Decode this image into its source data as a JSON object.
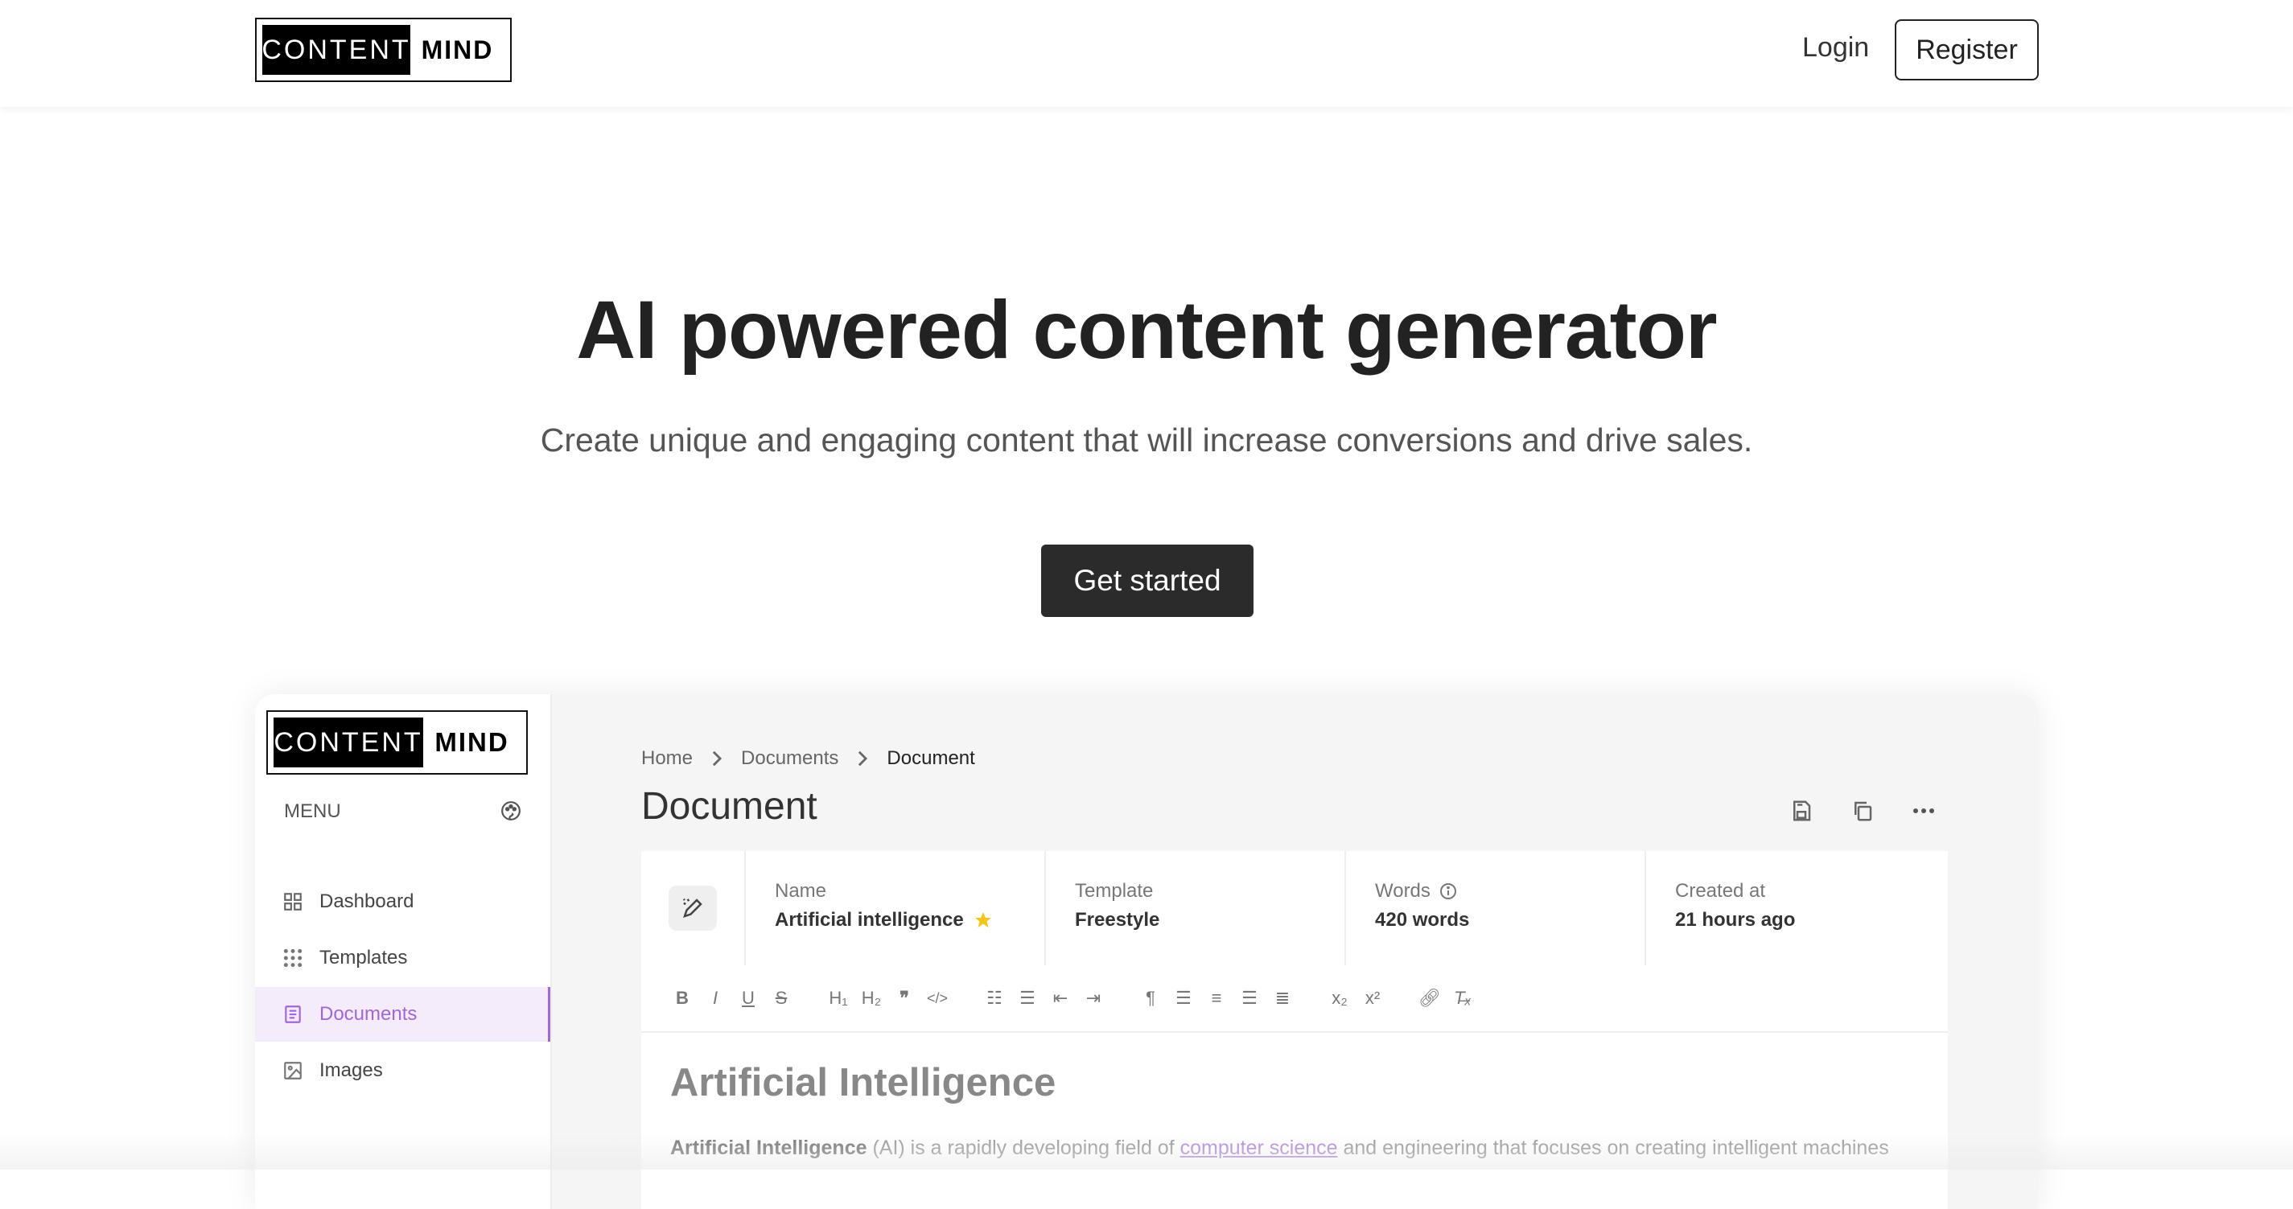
{
  "brand": {
    "part1": "CONTENT",
    "part2": "MIND"
  },
  "nav": {
    "login": "Login",
    "register": "Register"
  },
  "hero": {
    "title": "AI powered content generator",
    "subtitle": "Create unique and engaging content that will increase conversions and drive sales.",
    "cta": "Get started"
  },
  "app": {
    "sidebar": {
      "menu_label": "MENU",
      "items": [
        {
          "label": "Dashboard",
          "icon": "grid-icon",
          "active": false
        },
        {
          "label": "Templates",
          "icon": "dots-grid-icon",
          "active": false
        },
        {
          "label": "Documents",
          "icon": "document-icon",
          "active": true
        },
        {
          "label": "Images",
          "icon": "image-icon",
          "active": false
        }
      ]
    },
    "breadcrumb": [
      "Home",
      "Documents",
      "Document"
    ],
    "page_title": "Document",
    "actions": [
      "save-icon",
      "copy-icon",
      "more-icon"
    ],
    "meta": {
      "name_label": "Name",
      "name_value": "Artificial intelligence",
      "template_label": "Template",
      "template_value": "Freestyle",
      "words_label": "Words",
      "words_value": "420 words",
      "created_label": "Created at",
      "created_value": "21 hours ago"
    },
    "toolbar_icons": [
      "bold-icon",
      "italic-icon",
      "underline-icon",
      "strike-icon",
      "h1-icon",
      "h2-icon",
      "quote-icon",
      "code-icon",
      "ordered-list-icon",
      "bullet-list-icon",
      "outdent-icon",
      "indent-icon",
      "rtl-icon",
      "align-left-icon",
      "align-center-icon",
      "align-right-icon",
      "justify-icon",
      "subscript-icon",
      "superscript-icon",
      "link-icon",
      "clear-format-icon"
    ],
    "editor": {
      "heading": "Artificial Intelligence",
      "para_bold": "Artificial Intelligence",
      "para_text1": " (AI) is a rapidly developing field of ",
      "para_link": "computer science",
      "para_text2": " and engineering that focuses on creating intelligent machines"
    }
  },
  "colors": {
    "accent": "#a166d8",
    "cta_bg": "#2b2b2b",
    "star": "#f5c518"
  }
}
